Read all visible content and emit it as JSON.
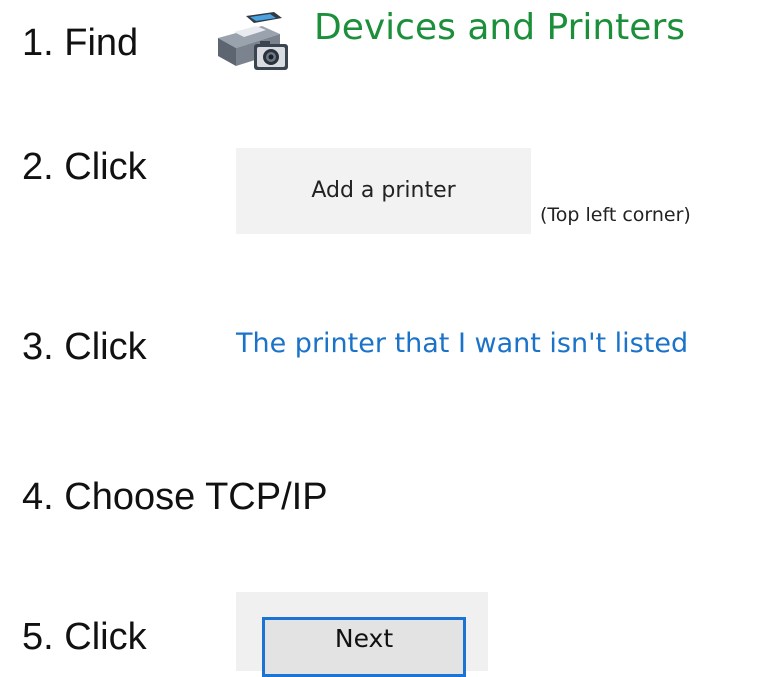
{
  "steps": [
    {
      "label": "1.  Find"
    },
    {
      "label": "2.  Click"
    },
    {
      "label": "3.  Click"
    },
    {
      "label": "4.  Choose TCP/IP"
    },
    {
      "label": "5.  Click"
    }
  ],
  "devices_and_printers": {
    "icon": "devices-and-printers-icon",
    "text": "Devices and Printers",
    "text_color": "#1b8f3a"
  },
  "add_printer": {
    "label": "Add a printer",
    "note": "(Top left corner)"
  },
  "printer_link": {
    "text": "The printer that I want isn't listed",
    "color": "#1a73c9"
  },
  "next_button": {
    "label": "Next",
    "border_color": "#1b74d4"
  }
}
